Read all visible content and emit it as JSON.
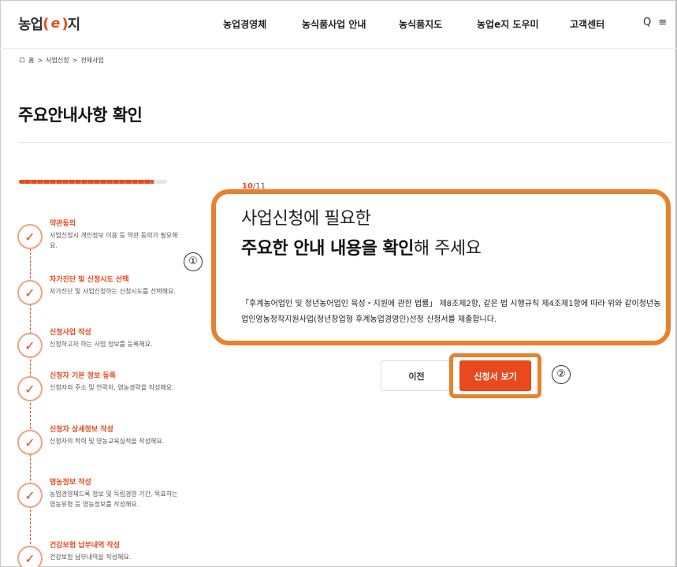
{
  "header": {
    "logo": {
      "prefix": "농업",
      "open": "(",
      "mark": "e",
      "close": ")",
      "suffix": "지"
    },
    "nav": [
      {
        "label": "농업경영체"
      },
      {
        "label": "농식품사업 안내"
      },
      {
        "label": "농식품지도"
      },
      {
        "label": "농업e지 도우미"
      },
      {
        "label": "고객센터"
      }
    ],
    "search_glyph": "Q",
    "menu_glyph": "≡"
  },
  "breadcrumb": {
    "items": [
      "홈",
      "사업신청",
      "전체사업"
    ],
    "separator": ">"
  },
  "page_title": "주요안내사항 확인",
  "progress": {
    "current": 10,
    "total": 11,
    "current_label": "10",
    "total_label": "/11"
  },
  "steps": [
    {
      "title": "약관동의",
      "desc": "사업신청시 개인정보 이용 등 약관 동의가 필요해요."
    },
    {
      "title": "자가진단 및 신청시도 선택",
      "desc": "자가진단 및 사업신청하는 신청시도를 선택해요."
    },
    {
      "title": "신청사업 작성",
      "desc": "신청하고자 하는 사업 정보를 등록해요."
    },
    {
      "title": "신청자 기본 정보 등록",
      "desc": "신청자의 주소 및 연락처, 영농경력을 작성해요."
    },
    {
      "title": "신청자 상세정보 작성",
      "desc": "신청자의 학력 및 영농교육실적을 작성해요."
    },
    {
      "title": "영농정보 작성",
      "desc": "농업경영체드록 정보 및 독립경영 기간, 목표하는 영농유형 등 영농정보를 작성해요."
    },
    {
      "title": "건강보험 납부내역 작성",
      "desc": "건강보험 납부내역을 작성해요."
    }
  ],
  "content": {
    "headline_line1": "사업신청에 필요한",
    "headline_bold": "주요한 안내 내용을 확인",
    "headline_rest": "해 주세요",
    "legal_text": "「후계농어업인 및 청년농어업인 육성・지원에 관한 법률」 제8조제2항, 같은 법 시행규칙 제4조제1항에 따라 위와 같이청년농업인영농정착지원사업(청년창업형 후계농업경영인)선정 신청서를 제출합니다."
  },
  "buttons": {
    "prev": "이전",
    "view": "신청서 보기"
  },
  "annotations": {
    "one": "①",
    "two": "②"
  },
  "colors": {
    "accent": "#e8491d",
    "highlight": "#e8812d"
  }
}
